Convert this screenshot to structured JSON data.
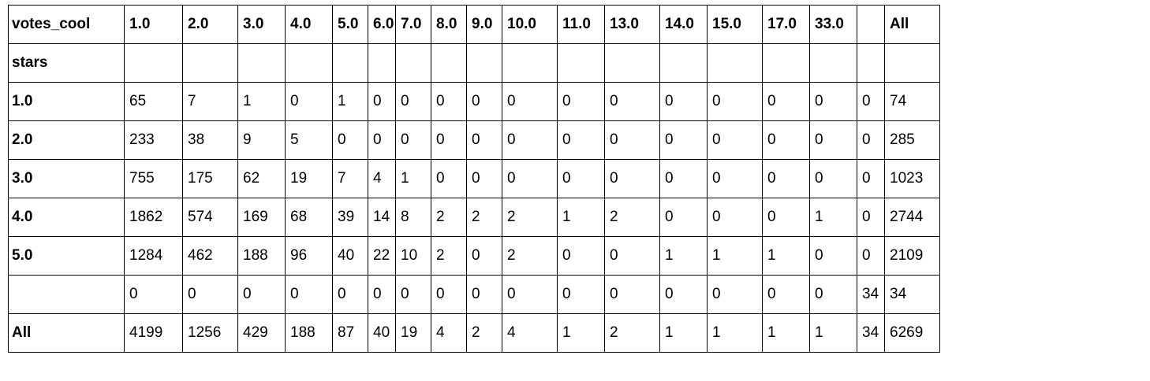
{
  "table": {
    "column_axis_label": "votes_cool",
    "row_axis_label": "stars",
    "columns": [
      "1.0",
      "2.0",
      "3.0",
      "4.0",
      "5.0",
      "6.0",
      "7.0",
      "8.0",
      "9.0",
      "10.0",
      "11.0",
      "13.0",
      "14.0",
      "15.0",
      "17.0",
      "33.0",
      "",
      "All"
    ],
    "rows": [
      {
        "label": "1.0",
        "cells": [
          "65",
          "7",
          "1",
          "0",
          "1",
          "0",
          "0",
          "0",
          "0",
          "0",
          "0",
          "0",
          "0",
          "0",
          "0",
          "0",
          "0",
          "74"
        ]
      },
      {
        "label": "2.0",
        "cells": [
          "233",
          "38",
          "9",
          "5",
          "0",
          "0",
          "0",
          "0",
          "0",
          "0",
          "0",
          "0",
          "0",
          "0",
          "0",
          "0",
          "0",
          "285"
        ]
      },
      {
        "label": "3.0",
        "cells": [
          "755",
          "175",
          "62",
          "19",
          "7",
          "4",
          "1",
          "0",
          "0",
          "0",
          "0",
          "0",
          "0",
          "0",
          "0",
          "0",
          "0",
          "1023"
        ]
      },
      {
        "label": "4.0",
        "cells": [
          "1862",
          "574",
          "169",
          "68",
          "39",
          "14",
          "8",
          "2",
          "2",
          "2",
          "1",
          "2",
          "0",
          "0",
          "0",
          "1",
          "0",
          "2744"
        ]
      },
      {
        "label": "5.0",
        "cells": [
          "1284",
          "462",
          "188",
          "96",
          "40",
          "22",
          "10",
          "2",
          "0",
          "2",
          "0",
          "0",
          "1",
          "1",
          "1",
          "0",
          "0",
          "2109"
        ]
      },
      {
        "label": "",
        "cells": [
          "0",
          "0",
          "0",
          "0",
          "0",
          "0",
          "0",
          "0",
          "0",
          "0",
          "0",
          "0",
          "0",
          "0",
          "0",
          "0",
          "34",
          "34"
        ]
      },
      {
        "label": "All",
        "cells": [
          "4199",
          "1256",
          "429",
          "188",
          "87",
          "40",
          "19",
          "4",
          "2",
          "4",
          "1",
          "2",
          "1",
          "1",
          "1",
          "1",
          "34",
          "6269"
        ]
      }
    ]
  }
}
